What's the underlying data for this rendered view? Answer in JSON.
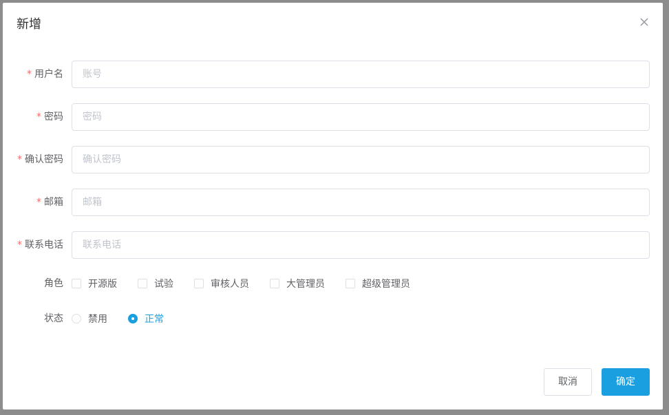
{
  "dialog": {
    "title": "新增",
    "close_icon": "close-icon"
  },
  "form": {
    "username": {
      "label": "用户名",
      "required": "*",
      "placeholder": "账号",
      "value": ""
    },
    "password": {
      "label": "密码",
      "required": "*",
      "placeholder": "密码",
      "value": ""
    },
    "confirm_password": {
      "label": "确认密码",
      "required": "*",
      "placeholder": "确认密码",
      "value": ""
    },
    "email": {
      "label": "邮箱",
      "required": "*",
      "placeholder": "邮箱",
      "value": ""
    },
    "phone": {
      "label": "联系电话",
      "required": "*",
      "placeholder": "联系电话",
      "value": ""
    },
    "roles": {
      "label": "角色",
      "options": [
        "开源版",
        "试验",
        "审核人员",
        "大管理员",
        "超级管理员"
      ]
    },
    "status": {
      "label": "状态",
      "options": [
        "禁用",
        "正常"
      ],
      "selected": "正常"
    }
  },
  "footer": {
    "cancel_label": "取消",
    "confirm_label": "确定"
  },
  "colors": {
    "primary": "#1a9fe0",
    "required": "#f56c6c",
    "overlay": "#8c8c8c"
  }
}
